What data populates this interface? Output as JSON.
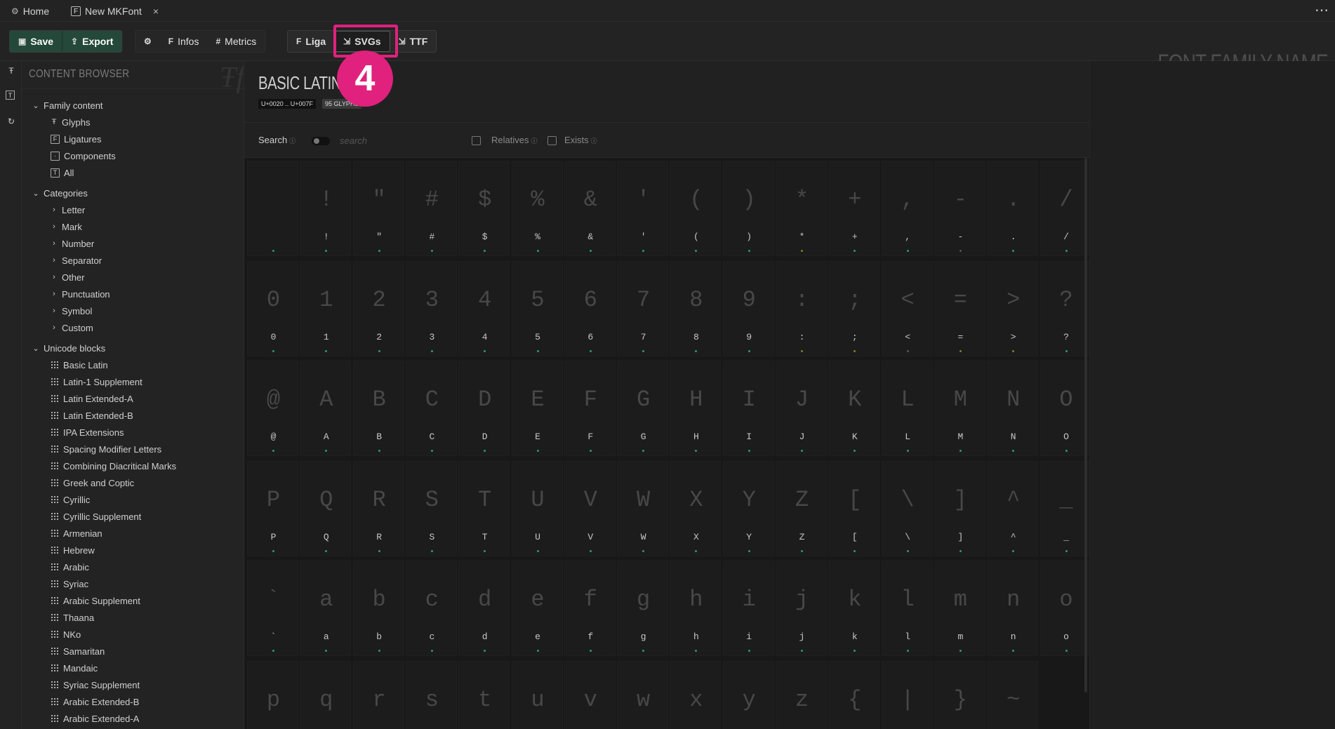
{
  "tabs": [
    {
      "label": "Home",
      "icon": "gear-icon"
    },
    {
      "label": "New MKFont",
      "icon": "font-file-icon",
      "close": "×"
    }
  ],
  "more_label": "⋯",
  "toolbar": {
    "save_label": "Save",
    "export_label": "Export",
    "infos_label": "Infos",
    "metrics_label": "Metrics",
    "liga_label": "Liga",
    "svgs_label": "SVGs",
    "ttf_label": "TTF",
    "family_name": "FONT FAMILY NAME"
  },
  "callout": {
    "number": "4",
    "color": "#e0217d"
  },
  "sidebar": {
    "title": "CONTENT BROWSER",
    "family_content": {
      "label": "Family content",
      "items": [
        {
          "label": "Glyphs",
          "icon": "glyphs-icon"
        },
        {
          "label": "Ligatures",
          "icon": "ligature-icon"
        },
        {
          "label": "Components",
          "icon": "component-icon"
        },
        {
          "label": "All",
          "icon": "text-icon"
        }
      ]
    },
    "categories": {
      "label": "Categories",
      "items": [
        "Letter",
        "Mark",
        "Number",
        "Separator",
        "Other",
        "Punctuation",
        "Symbol",
        "Custom"
      ]
    },
    "unicode_blocks": {
      "label": "Unicode blocks",
      "items": [
        "Basic Latin",
        "Latin-1 Supplement",
        "Latin Extended-A",
        "Latin Extended-B",
        "IPA Extensions",
        "Spacing Modifier Letters",
        "Combining Diacritical Marks",
        "Greek and Coptic",
        "Cyrillic",
        "Cyrillic Supplement",
        "Armenian",
        "Hebrew",
        "Arabic",
        "Syriac",
        "Arabic Supplement",
        "Thaana",
        "NKo",
        "Samaritan",
        "Mandaic",
        "Syriac Supplement",
        "Arabic Extended-B",
        "Arabic Extended-A"
      ]
    }
  },
  "main": {
    "block_title": "BASIC LATIN",
    "range": "U+0020 .. U+007F",
    "glyph_count": "95 GLYPHS",
    "search_label": "Search",
    "search_placeholder": "search",
    "relatives_label": "Relatives",
    "exists_label": "Exists",
    "info_symbol": "ⓘ"
  },
  "glyphs": [
    " ",
    "!",
    "\"",
    "#",
    "$",
    "%",
    "&",
    "'",
    "(",
    ")",
    "*",
    "+",
    ",",
    "-",
    ".",
    "/",
    "0",
    "1",
    "2",
    "3",
    "4",
    "5",
    "6",
    "7",
    "8",
    "9",
    ":",
    ";",
    "<",
    "=",
    ">",
    "?",
    "@",
    "A",
    "B",
    "C",
    "D",
    "E",
    "F",
    "G",
    "H",
    "I",
    "J",
    "K",
    "L",
    "M",
    "N",
    "O",
    "P",
    "Q",
    "R",
    "S",
    "T",
    "U",
    "V",
    "W",
    "X",
    "Y",
    "Z",
    "[",
    "\\",
    "]",
    "^",
    "_",
    "`",
    "a",
    "b",
    "c",
    "d",
    "e",
    "f",
    "g",
    "h",
    "i",
    "j",
    "k",
    "l",
    "m",
    "n",
    "o",
    "p",
    "q",
    "r",
    "s",
    "t",
    "u",
    "v",
    "w",
    "x",
    "y",
    "z",
    "{",
    "|",
    "}",
    "~"
  ],
  "colors": {
    "accent": "#24483a",
    "highlight": "#e0217d",
    "exists_dot": "#2e9a6b"
  }
}
